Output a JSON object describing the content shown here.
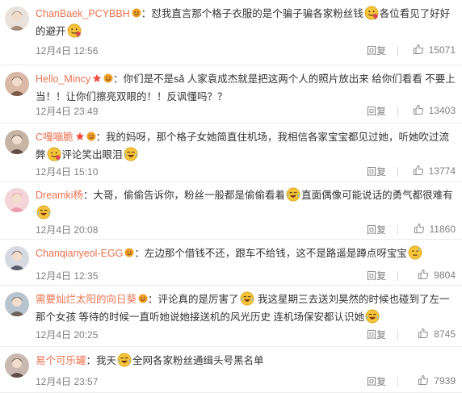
{
  "comments": [
    {
      "username": "ChanBaek_PCYBBH",
      "badges": [
        "emoji-badge"
      ],
      "segments": [
        {
          "t": "text",
          "v": "：怼我直言那个格子衣服的是个骗子骗各家粉丝钱"
        },
        {
          "t": "emoji",
          "v": "rose-emoji"
        },
        {
          "t": "text",
          "v": "各位看见了好好的避开"
        },
        {
          "t": "emoji",
          "v": "rose-emoji"
        }
      ],
      "date": "12月4日 12:56",
      "reply": "回复",
      "likes": "15071",
      "avatar_color": "#e9e2dc"
    },
    {
      "username": "Hello_Mincy",
      "badges": [
        "star-badge",
        "emoji-badge"
      ],
      "segments": [
        {
          "t": "text",
          "v": "：你们是不是sǎ 人家袁成杰就是把这两个人的照片放出来 给你们看看 不要上当！！让你们擦亮双眼的！！反讽懂吗？？"
        }
      ],
      "date": "12月4日 23:49",
      "reply": "回复",
      "likes": "13403",
      "avatar_color": "#d9b9a5"
    },
    {
      "username": "C嘎嘣脆",
      "badges": [
        "star-badge",
        "emoji-badge"
      ],
      "segments": [
        {
          "t": "text",
          "v": "：我的妈呀，那个格子女她简直住机场，我相信各家宝宝都见过她，听她吹过流弊"
        },
        {
          "t": "emoji",
          "v": "rose-emoji"
        },
        {
          "t": "text",
          "v": "评论笑出眼泪"
        },
        {
          "t": "emoji",
          "v": "laugh-cry-emoji"
        }
      ],
      "date": "12月4日 15:10",
      "reply": "回复",
      "likes": "13774",
      "avatar_color": "#c8b4a4"
    },
    {
      "username": "Dreamki杨",
      "badges": [],
      "segments": [
        {
          "t": "text",
          "v": "：大哥，偷偷告诉你，粉丝一般都是偷偷看着"
        },
        {
          "t": "emoji",
          "v": "laugh-cry-emoji"
        },
        {
          "t": "text",
          "v": "直面偶像可能说话的勇气都很难有"
        },
        {
          "t": "emoji",
          "v": "laugh-cry-emoji"
        }
      ],
      "date": "12月4日 20:08",
      "reply": "回复",
      "likes": "11860",
      "avatar_color": "#f3d5d8"
    },
    {
      "username": "Chanqianyeol-EGG",
      "badges": [
        "emoji-badge"
      ],
      "segments": [
        {
          "t": "text",
          "v": "：左边那个借钱不还，跟车不给钱，这不是路遥是蹲点呀宝宝"
        },
        {
          "t": "emoji",
          "v": "sweat-emoji"
        }
      ],
      "date": "12月4日 12:35",
      "reply": "回复",
      "likes": "9804",
      "avatar_color": "#d6d9e0"
    },
    {
      "username": "需要灿烂太阳的向日葵",
      "badges": [
        "emoji-badge"
      ],
      "segments": [
        {
          "t": "text",
          "v": "：评论真的是厉害了"
        },
        {
          "t": "emoji",
          "v": "laugh-cry-emoji"
        },
        {
          "t": "text",
          "v": " 我这星期三去送刘昊然的时候也碰到了左一那个女孩 等待的时候一直听她说她接送机的风光历史 连机场保安都认识她"
        },
        {
          "t": "emoji",
          "v": "laugh-cry-emoji"
        }
      ],
      "date": "12月4日 20:25",
      "reply": "回复",
      "likes": "8745",
      "avatar_color": "#b7c3cf"
    },
    {
      "username": "易个可乐罐",
      "badges": [],
      "segments": [
        {
          "t": "text",
          "v": "：我天"
        },
        {
          "t": "emoji",
          "v": "laugh-cry-emoji"
        },
        {
          "t": "text",
          "v": "全网各家粉丝通缉头号黑名单"
        }
      ],
      "date": "12月4日 23:57",
      "reply": "回复",
      "likes": "7939",
      "avatar_color": "#c9b8b0"
    }
  ]
}
